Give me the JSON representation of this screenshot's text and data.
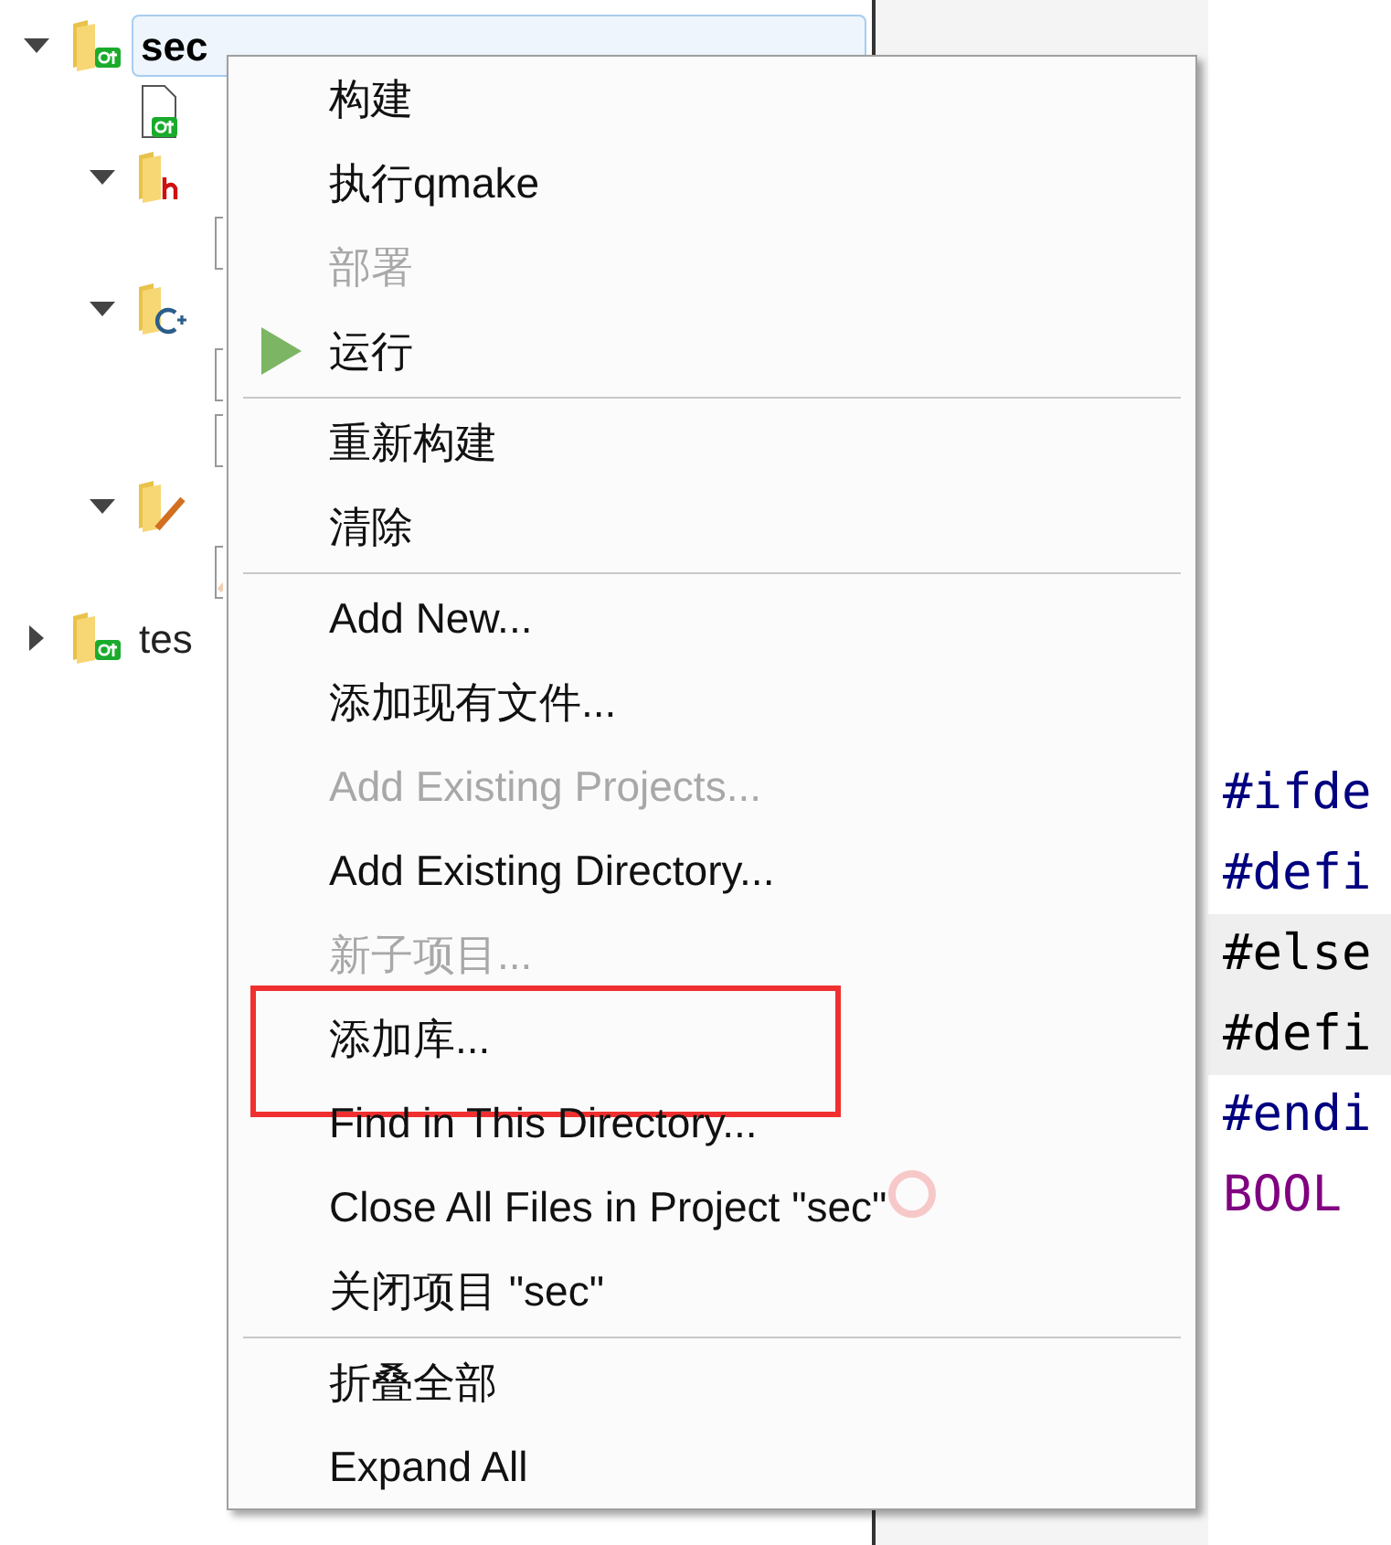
{
  "tree": [
    {
      "label": "sec",
      "kind": "qt-project",
      "expanded": true,
      "selected": true,
      "children": [
        {
          "kind": "pro-file"
        },
        {
          "kind": "header-folder",
          "expanded": true,
          "children": [
            {
              "kind": "header-file"
            }
          ]
        },
        {
          "kind": "source-folder",
          "expanded": true,
          "children": [
            {
              "kind": "cpp-file"
            },
            {
              "kind": "cpp-file"
            }
          ]
        },
        {
          "kind": "form-folder",
          "expanded": true,
          "children": [
            {
              "kind": "ui-file"
            }
          ]
        }
      ]
    },
    {
      "label": "tes",
      "kind": "qt-project",
      "expanded": false,
      "selected": false
    }
  ],
  "editor": {
    "lines": [
      {
        "text": "#ifde",
        "kind": "directive",
        "shaded": false
      },
      {
        "text": "#defi",
        "kind": "directive",
        "shaded": false
      },
      {
        "text": "#else",
        "kind": "plain",
        "shaded": true
      },
      {
        "text": "#defi",
        "kind": "plain",
        "shaded": true
      },
      {
        "text": "#endi",
        "kind": "directive",
        "shaded": false
      },
      {
        "text": "BOOL",
        "kind": "type",
        "shaded": false
      }
    ]
  },
  "context_menu": {
    "items": [
      {
        "kind": "item",
        "label": "构建",
        "disabled": false,
        "outlined": false
      },
      {
        "kind": "item",
        "label": "执行qmake",
        "disabled": false,
        "outlined": false
      },
      {
        "kind": "item",
        "label": "部署",
        "disabled": true,
        "outlined": false
      },
      {
        "kind": "run",
        "label": "运行",
        "disabled": false,
        "outlined": false
      },
      {
        "kind": "separator"
      },
      {
        "kind": "item",
        "label": "重新构建",
        "disabled": false,
        "outlined": false
      },
      {
        "kind": "item",
        "label": "清除",
        "disabled": false,
        "outlined": false
      },
      {
        "kind": "separator"
      },
      {
        "kind": "item",
        "label": "Add New...",
        "disabled": false,
        "outlined": false
      },
      {
        "kind": "item",
        "label": "添加现有文件...",
        "disabled": false,
        "outlined": false
      },
      {
        "kind": "item",
        "label": "Add Existing Projects...",
        "disabled": true,
        "outlined": false
      },
      {
        "kind": "item",
        "label": "Add Existing Directory...",
        "disabled": false,
        "outlined": false
      },
      {
        "kind": "item",
        "label": "新子项目...",
        "disabled": true,
        "outlined": false
      },
      {
        "kind": "item",
        "label": "添加库...",
        "disabled": false,
        "outlined": true
      },
      {
        "kind": "item",
        "label": "Find in This Directory...",
        "disabled": false,
        "outlined": false
      },
      {
        "kind": "item",
        "label": "Close All Files in Project \"sec\"",
        "disabled": false,
        "outlined": false
      },
      {
        "kind": "item",
        "label": "关闭项目 \"sec\"",
        "disabled": false,
        "outlined": false
      },
      {
        "kind": "separator"
      },
      {
        "kind": "item",
        "label": "折叠全部",
        "disabled": false,
        "outlined": false
      },
      {
        "kind": "item",
        "label": "Expand All",
        "disabled": false,
        "outlined": false
      }
    ]
  }
}
